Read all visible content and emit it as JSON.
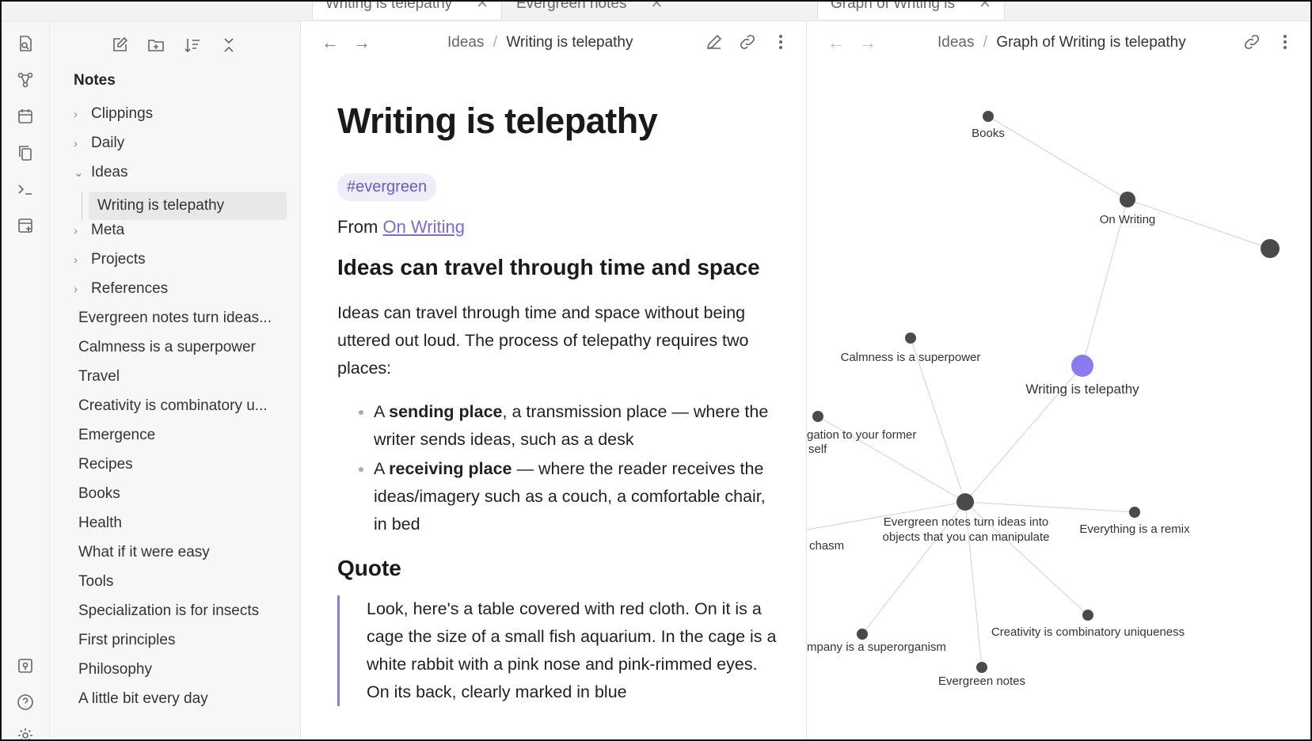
{
  "tabs": [
    {
      "label": "Writing is telepathy"
    },
    {
      "label": "Evergreen notes"
    },
    {
      "label": "Graph of Writing is"
    }
  ],
  "sidebar": {
    "root": "Notes",
    "folders": [
      "Clippings",
      "Daily",
      "Ideas"
    ],
    "ideas_child": "Writing is telepathy",
    "folders2": [
      "Meta",
      "Projects",
      "References"
    ],
    "files": [
      "Evergreen notes turn ideas...",
      "Calmness is a superpower",
      "Travel",
      "Creativity is combinatory u...",
      "Emergence",
      "Recipes",
      "Books",
      "Health",
      "What if it were easy",
      "Tools",
      "Specialization is for insects",
      "First principles",
      "Philosophy",
      "A little bit every day"
    ]
  },
  "note_pane": {
    "breadcrumb_parent": "Ideas",
    "breadcrumb_sep": "/",
    "breadcrumb_current": "Writing is telepathy",
    "title": "Writing is telepathy",
    "tag": "#evergreen",
    "from_prefix": "From",
    "from_link": "On Writing",
    "h2_1": "Ideas can travel through time and space",
    "p1": "Ideas can travel through time and space without being uttered out loud. The process of telepathy requires two places:",
    "bullets": [
      {
        "prefix": "A ",
        "bold": "sending place",
        "rest": ", a transmission place — where the writer sends ideas, such as a desk"
      },
      {
        "prefix": "A ",
        "bold": "receiving place",
        "rest": " — where the reader receives the ideas/imagery such as a couch, a comfortable chair, in bed"
      }
    ],
    "h2_2": "Quote",
    "quote": "Look, here's a table covered with red cloth. On it is a cage the size of a small fish aquarium. In the cage is a white rabbit with a pink nose and pink-rimmed eyes. On its back, clearly marked in blue"
  },
  "graph_pane": {
    "breadcrumb_parent": "Ideas",
    "breadcrumb_sep": "/",
    "breadcrumb_current": "Graph of Writing is telepathy",
    "nodes": {
      "books": "Books",
      "on_writing": "On Writing",
      "calmness": "Calmness is a superpower",
      "writing": "Writing is telepathy",
      "former_self_1": "gation to your former",
      "former_self_2": "self",
      "evergreen_1": "Evergreen notes turn ideas into",
      "evergreen_2": "objects that you can manipulate",
      "remix": "Everything is a remix",
      "chasm": "chasm",
      "creativity": "Creativity is combinatory uniqueness",
      "company": "mpany is a superorganism",
      "evergreen_notes": "Evergreen notes"
    },
    "accent_node_color": "#8a7cf0",
    "node_color": "#4a4a4a"
  }
}
